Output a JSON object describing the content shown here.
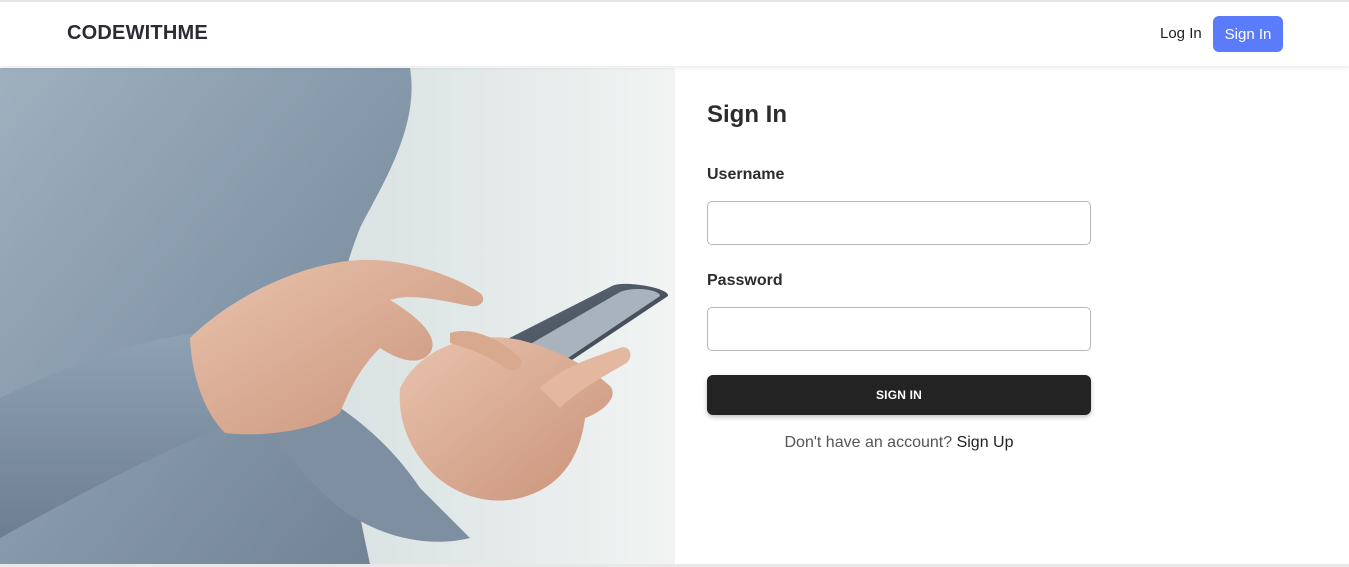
{
  "navbar": {
    "brand": "CODEWITHME",
    "login_label": "Log In",
    "signin_label": "Sign In",
    "accent_color": "#5b7cfa"
  },
  "hero": {
    "image": "person-using-smartphone-photo"
  },
  "form": {
    "title": "Sign In",
    "username_label": "Username",
    "username_value": "",
    "password_label": "Password",
    "password_value": "",
    "submit_label": "SIGN IN",
    "signup_prompt": "Don't have an account?",
    "signup_link": "Sign Up",
    "button_color": "#232323"
  }
}
